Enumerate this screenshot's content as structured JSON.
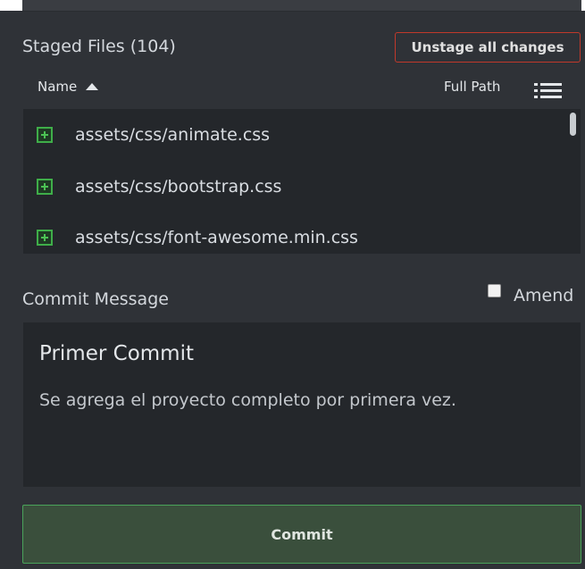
{
  "staged": {
    "title": "Staged Files (104)",
    "unstage_label": "Unstage all changes",
    "columns": {
      "name": "Name",
      "full_path": "Full Path"
    },
    "files": [
      {
        "name": "assets/css/animate.css",
        "icon": "file-added-icon"
      },
      {
        "name": "assets/css/bootstrap.css",
        "icon": "file-added-icon"
      },
      {
        "name": "assets/css/font-awesome.min.css",
        "icon": "file-added-icon"
      }
    ]
  },
  "commit": {
    "section_title": "Commit Message",
    "amend_label": "Amend",
    "amend_checked": false,
    "message_title": "Primer Commit",
    "message_body": "Se agrega el proyecto completo por primera vez.",
    "button_label": "Commit"
  },
  "colors": {
    "background": "#2f3237",
    "panel": "#24272b",
    "danger": "#c0392b",
    "success": "#4aa35a",
    "added_icon": "#3fae49"
  }
}
